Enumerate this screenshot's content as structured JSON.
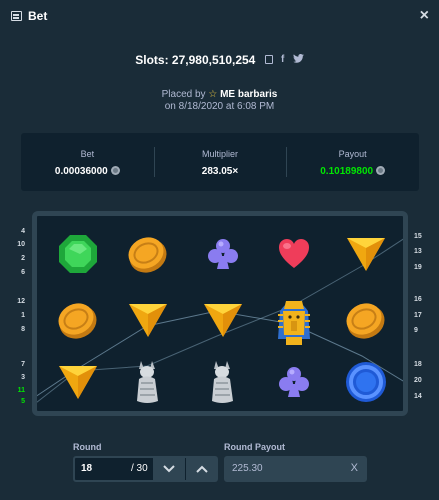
{
  "header": {
    "title": "Bet",
    "close": "×"
  },
  "slots": {
    "label": "Slots: 27,980,510,254"
  },
  "placed": {
    "prefix": "Placed by",
    "user": "ME barbaris",
    "date": "on 8/18/2020 at 6:08 PM"
  },
  "summary": {
    "bet_label": "Bet",
    "bet_value": "0.00036000",
    "multiplier_label": "Multiplier",
    "multiplier_value": "283.05×",
    "payout_label": "Payout",
    "payout_value": "0.10189800"
  },
  "paylines": {
    "left": [
      "4",
      "10",
      "2",
      "6",
      "12",
      "1",
      "8",
      "7",
      "3",
      "11",
      "5"
    ],
    "right": [
      "15",
      "13",
      "19",
      "16",
      "17",
      "9",
      "18",
      "20",
      "14"
    ],
    "active": [
      "11",
      "5"
    ]
  },
  "reels": [
    [
      "gem-green",
      "coin-gold",
      "diamond-yellow"
    ],
    [
      "coin-gold",
      "diamond-yellow",
      "cat-statue"
    ],
    [
      "club-purple",
      "diamond-yellow",
      "cat-statue"
    ],
    [
      "heart-red",
      "pharaoh",
      "club-purple"
    ],
    [
      "diamond-yellow",
      "coin-gold",
      "ring-blue"
    ]
  ],
  "round": {
    "label": "Round",
    "value": "18",
    "total": "/ 30"
  },
  "round_payout": {
    "label": "Round Payout",
    "value": "225.30",
    "clear": "X"
  },
  "colors": {
    "bg": "#1a2c38",
    "panel": "#0f212e",
    "border": "#2f4553",
    "green": "#00e701",
    "muted": "#b1bad3"
  }
}
